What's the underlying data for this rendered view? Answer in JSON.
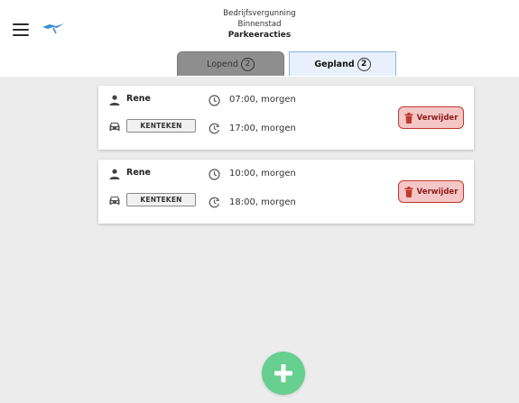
{
  "header": {
    "line1": "Bedrijfsvergunning",
    "line2": "Binnenstad",
    "title": "Parkeeracties"
  },
  "tabs": [
    {
      "label": "Lopend",
      "count": "2",
      "active": false
    },
    {
      "label": "Gepland",
      "count": "2",
      "active": true
    }
  ],
  "cards": [
    {
      "user": "Rene",
      "plate": "KENTEKEN",
      "start": "07:00, morgen",
      "end": "17:00, morgen",
      "delete_label": "Verwijder"
    },
    {
      "user": "Rene",
      "plate": "KENTEKEN",
      "start": "10:00, morgen",
      "end": "18:00, morgen",
      "delete_label": "Verwijder"
    }
  ],
  "icons": {
    "menu": "hamburger-menu-icon",
    "logo": "bird-logo-icon",
    "user": "person-icon",
    "car": "car-icon",
    "start": "clock-icon",
    "end": "clock-rotate-icon",
    "delete": "trash-icon",
    "add": "plus-icon"
  },
  "colors": {
    "accent_green": "#67cf8f",
    "delete_bg": "#f5c6c6",
    "delete_border": "#c0392b",
    "active_tab_bg": "#e8f1fb",
    "inactive_tab_bg": "#8e8e8e",
    "logo_blue": "#3a8fd6"
  }
}
